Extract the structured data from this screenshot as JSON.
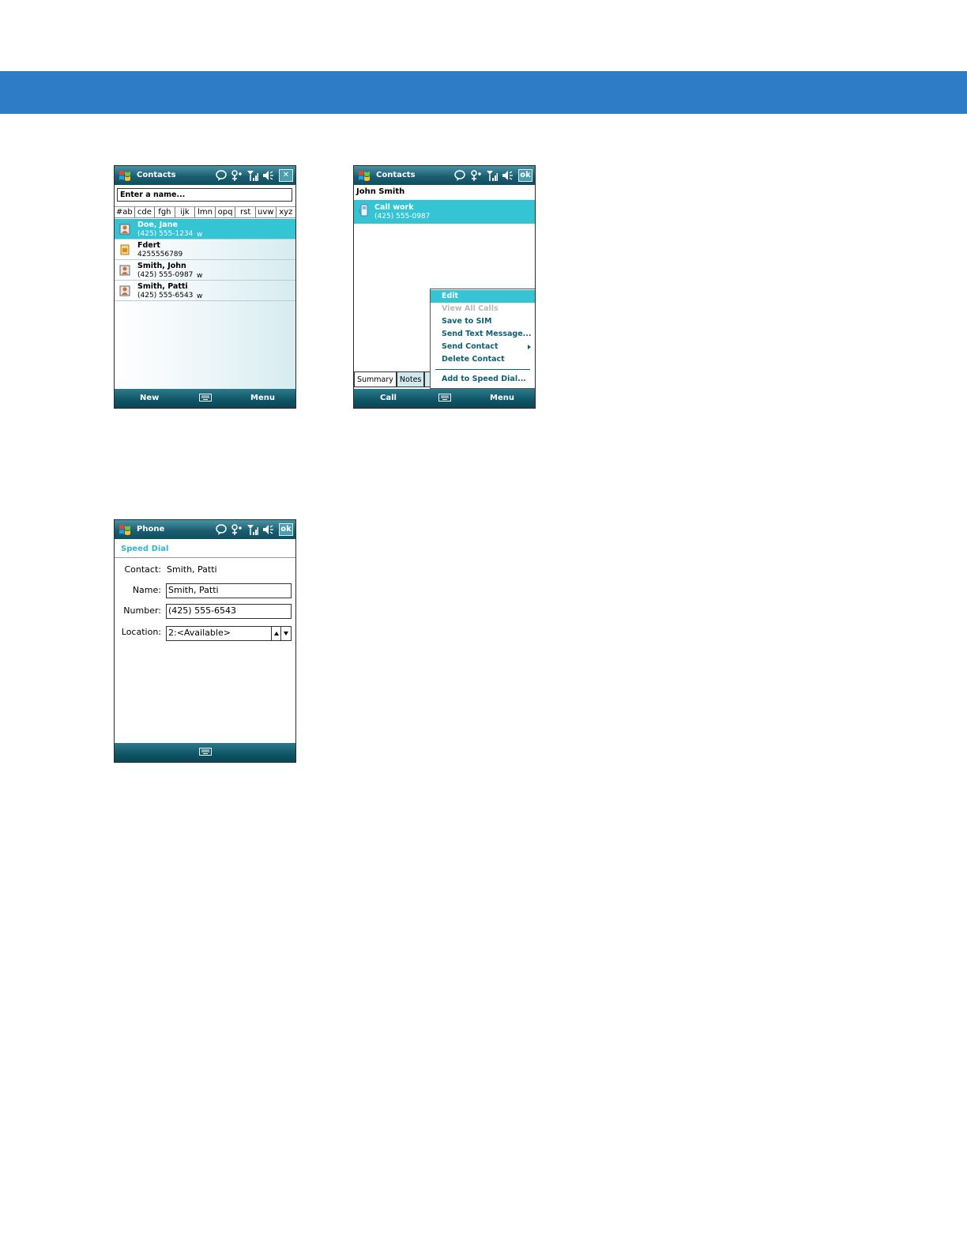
{
  "screen1": {
    "title": "Contacts",
    "close_label": "✕",
    "search_placeholder": "Enter a name...",
    "alpha_tabs": [
      "#ab",
      "cde",
      "fgh",
      "ijk",
      "lmn",
      "opq",
      "rst",
      "uvw",
      "xyz"
    ],
    "contacts": [
      {
        "name": "Doe, Jane",
        "phone": "(425) 555-1234",
        "tag": "w",
        "selected": true
      },
      {
        "name": "Fdert",
        "phone": "4255556789",
        "tag": "",
        "selected": false
      },
      {
        "name": "Smith, John",
        "phone": "(425) 555-0987",
        "tag": "w",
        "selected": false
      },
      {
        "name": "Smith, Patti",
        "phone": "(425) 555-6543",
        "tag": "w",
        "selected": false
      }
    ],
    "left_soft": "New",
    "right_soft": "Menu"
  },
  "screen2": {
    "title": "Contacts",
    "ok_label": "ok",
    "contact_name": "John Smith",
    "call_label": "Call work",
    "call_phone": "(425) 555-0987",
    "menu_items": [
      {
        "label": "Edit",
        "state": "selected"
      },
      {
        "label": "View All Calls",
        "state": "disabled"
      },
      {
        "label": "Save to SIM",
        "state": "normal"
      },
      {
        "label": "Send Text Message...",
        "state": "normal"
      },
      {
        "label": "Send Contact",
        "state": "submenu"
      },
      {
        "label": "Delete Contact",
        "state": "normal"
      },
      {
        "label": "Add to Speed Dial...",
        "state": "normal"
      }
    ],
    "tab_summary": "Summary",
    "tab_notes": "Notes",
    "left_soft": "Call",
    "right_soft": "Menu"
  },
  "screen3": {
    "title": "Phone",
    "ok_label": "ok",
    "header": "Speed Dial",
    "contact_label": "Contact:",
    "contact_value": "Smith, Patti",
    "name_label": "Name:",
    "name_value": "Smith, Patti",
    "number_label": "Number:",
    "number_value": "(425) 555-6543",
    "location_label": "Location:",
    "location_value": "2:<Available>"
  },
  "colors": {
    "banner": "#2e7bc6",
    "selection": "#34c4d4",
    "menu_text": "#0f5f72",
    "header_accent": "#2eb7cd"
  },
  "icons": {
    "start": "windows-flag-icon",
    "status": [
      "notification-bubble-icon",
      "connectivity-icon",
      "signal-icon",
      "volume-icon"
    ],
    "keyboard": "keyboard-icon",
    "contact": "contact-card-icon",
    "sim": "sim-contact-icon",
    "phone": "phone-handset-icon"
  }
}
